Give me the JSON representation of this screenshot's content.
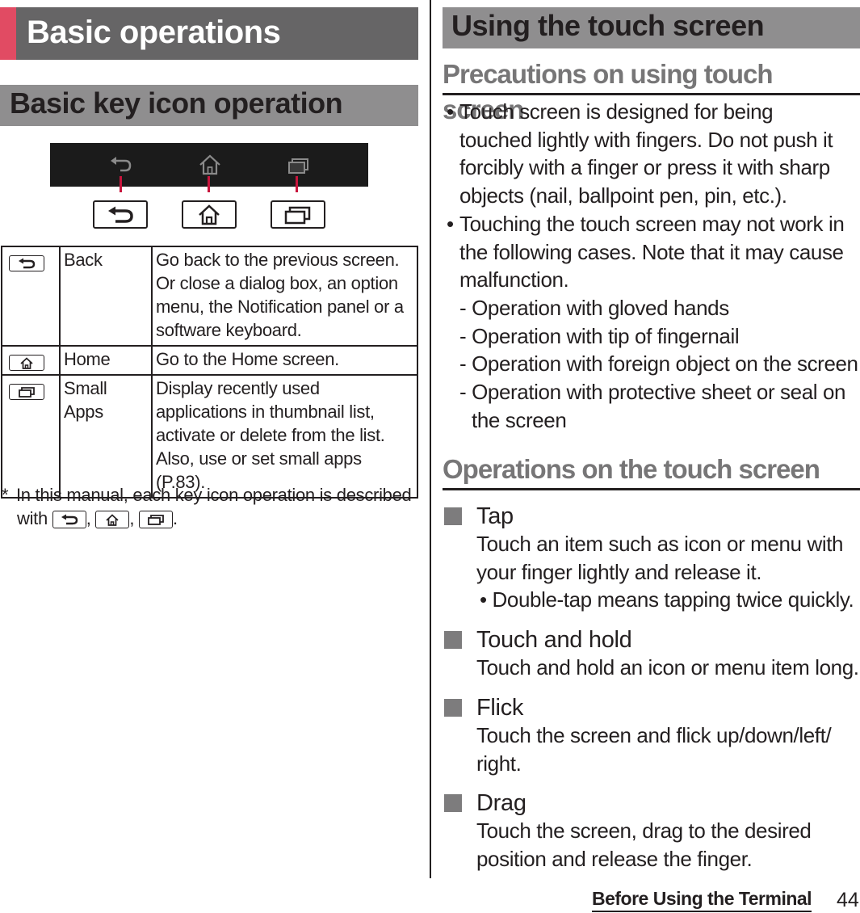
{
  "page": {
    "section_title": "Basic operations",
    "footer_chapter": "Before Using the Terminal",
    "page_number": "44",
    "colors": {
      "accent": "#e14b63",
      "section_bar": "#666566",
      "subsection_bar": "#8f8e8f",
      "pointer": "#c8143c",
      "heading_gray": "#777677"
    }
  },
  "left": {
    "heading": "Basic key icon operation",
    "nav_keys": [
      {
        "icon": "back-icon",
        "glyph": "⮌"
      },
      {
        "icon": "home-icon",
        "glyph": "⌂"
      },
      {
        "icon": "recent-apps-icon",
        "glyph": "❐"
      }
    ],
    "table": [
      {
        "icon": "back-icon",
        "name": "Back",
        "description": "Go back to the previous screen. Or close a dialog box, an option menu, the Notification panel or a software keyboard."
      },
      {
        "icon": "home-icon",
        "name": "Home",
        "description": "Go to the Home screen."
      },
      {
        "icon": "recent-apps-icon",
        "name": "Small Apps",
        "description": "Display recently used applications in thumbnail list, activate or delete from the list. Also, use or set small apps (P.83)."
      }
    ],
    "note": {
      "marker": "*",
      "line1": "In this manual, each key icon operation is described",
      "line2_prefix": "with",
      "sep1": ",",
      "sep2": ",",
      "end": "."
    }
  },
  "right": {
    "heading": "Using the touch screen",
    "precautions": {
      "title": "Precautions on using touch screen",
      "bullets": [
        "Touch screen is designed for being touched lightly with fingers. Do not push it forcibly with a finger or press it with sharp objects (nail, ballpoint pen, pin, etc.).",
        "Touching the touch screen may not work in the following cases. Note that it may cause malfunction."
      ],
      "cases": [
        "- Operation with gloved hands",
        "- Operation with tip of fingernail",
        "- Operation with foreign object on the screen",
        "- Operation with protective sheet or seal on the screen"
      ]
    },
    "operations": {
      "title": "Operations on the touch screen",
      "items": [
        {
          "name": "Tap",
          "description": "Touch an item such as icon or menu with your finger lightly and release it.",
          "sub_bullet": "Double-tap means tapping twice quickly."
        },
        {
          "name": "Touch and hold",
          "description": "Touch and hold an icon or menu item long."
        },
        {
          "name": "Flick",
          "description": "Touch the screen and flick up/down/left/ right."
        },
        {
          "name": "Drag",
          "description": "Touch the screen, drag to the desired position and release the finger."
        }
      ]
    }
  }
}
